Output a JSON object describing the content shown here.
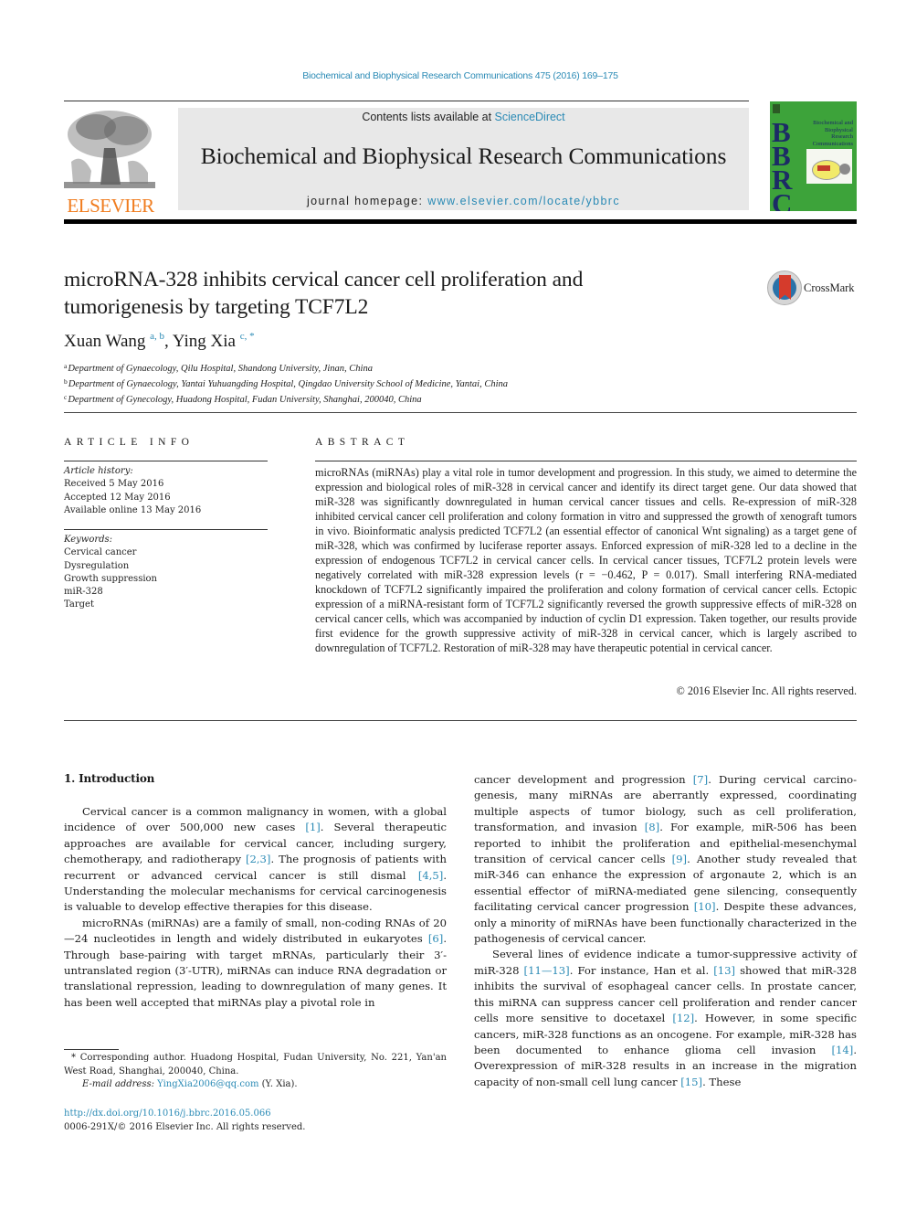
{
  "running_head": "Biochemical and Biophysical Research Communications 475 (2016) 169–175",
  "masthead": {
    "publisher_logo": "ELSEVIER",
    "contents_prefix": "Contents lists available at ",
    "contents_link": "ScienceDirect",
    "journal_title": "Biochemical and Biophysical Research Communications",
    "homepage_prefix": "journal homepage: ",
    "homepage_link": "www.elsevier.com/locate/ybbrc",
    "cover": {
      "letters": [
        "B",
        "B",
        "R",
        "C"
      ],
      "title_lines": [
        "Biochemical and",
        "Biophysical",
        "Research",
        "Communications"
      ],
      "background_color": "#3da33a"
    }
  },
  "article": {
    "title": "microRNA-328 inhibits cervical cancer cell proliferation and tumorigenesis by targeting TCF7L2",
    "crossmark_label": "CrossMark",
    "authors": [
      {
        "name": "Xuan Wang",
        "marks": "a, b"
      },
      {
        "name": "Ying Xia",
        "marks": "c, *"
      }
    ],
    "affiliations": [
      {
        "mark": "a",
        "text": "Department of Gynaecology, Qilu Hospital, Shandong University, Jinan, China"
      },
      {
        "mark": "b",
        "text": "Department of Gynaecology, Yantai Yuhuangding Hospital, Qingdao University School of Medicine, Yantai, China"
      },
      {
        "mark": "c",
        "text": "Department of Gynecology, Huadong Hospital, Fudan University, Shanghai, 200040, China"
      }
    ]
  },
  "article_info": {
    "heading": "ARTICLE INFO",
    "history_label": "Article history:",
    "history": [
      "Received 5 May 2016",
      "Accepted 12 May 2016",
      "Available online 13 May 2016"
    ],
    "keywords_label": "Keywords:",
    "keywords": [
      "Cervical cancer",
      "Dysregulation",
      "Growth suppression",
      "miR-328",
      "Target"
    ]
  },
  "abstract": {
    "heading": "ABSTRACT",
    "text": "microRNAs (miRNAs) play a vital role in tumor development and progression. In this study, we aimed to determine the expression and biological roles of miR-328 in cervical cancer and identify its direct target gene. Our data showed that miR-328 was significantly downregulated in human cervical cancer tissues and cells. Re-expression of miR-328 inhibited cervical cancer cell proliferation and colony formation in vitro and suppressed the growth of xenograft tumors in vivo. Bioinformatic analysis predicted TCF7L2 (an essential effector of canonical Wnt signaling) as a target gene of miR-328, which was confirmed by luciferase reporter assays. Enforced expression of miR-328 led to a decline in the expression of endog­enous TCF7L2 in cervical cancer cells. In cervical cancer tissues, TCF7L2 protein levels were negatively correlated with miR-328 expression levels (r = −0.462, P = 0.017). Small interfering RNA-mediated knockdown of TCF7L2 significantly impaired the proliferation and colony formation of cervical cancer cells. Ectopic expression of a miRNA-resistant form of TCF7L2 significantly reversed the growth sup­pressive effects of miR-328 on cervical cancer cells, which was accompanied by induction of cyclin D1 expression. Taken together, our results provide first evidence for the growth suppressive activity of miR-328 in cervical cancer, which is largely ascribed to downregulation of TCF7L2. Restoration of miR-328 may have therapeutic potential in cervical cancer.",
    "copyright": "© 2016 Elsevier Inc. All rights reserved."
  },
  "body": {
    "section_title": "1.  Introduction",
    "left_paragraphs": [
      [
        {
          "t": "Cervical cancer is a common malignancy in women, with a global incidence of over 500,000 new cases "
        },
        {
          "ref": "[1]"
        },
        {
          "t": ". Several therapeutic approaches are available for cervical cancer, including surgery, chemotherapy, and radiotherapy "
        },
        {
          "ref": "[2,3]"
        },
        {
          "t": ". The prognosis of patients with recurrent or advanced cervical cancer is still dismal "
        },
        {
          "ref": "[4,5]"
        },
        {
          "t": ". Understanding the molecular mechanisms for cervical carcino­genesis is valuable to develop effective therapies for this disease."
        }
      ],
      [
        {
          "t": "microRNAs (miRNAs) are a family of small, non-coding RNAs of 20—24 nucleotides in length and widely distributed in eukaryotes "
        },
        {
          "ref": "[6]"
        },
        {
          "t": ". Through base-pairing with target mRNAs, particularly their 3′-untranslated region (3′-UTR), miRNAs can induce RNA degradation or translational repression, leading to downregulation of many genes. It has been well accepted that miRNAs play a pivotal role in"
        }
      ]
    ],
    "right_paragraphs": [
      [
        {
          "t": "cancer development and progression "
        },
        {
          "ref": "[7]"
        },
        {
          "t": ". During cervical carcino­genesis, many miRNAs are aberrantly expressed, coordinating multiple aspects of tumor biology, such as cell proliferation, transformation, and invasion "
        },
        {
          "ref": "[8]"
        },
        {
          "t": ". For example, miR-506 has been reported to inhibit the proliferation and epithelial-mesenchymal transition of cervical cancer cells "
        },
        {
          "ref": "[9]"
        },
        {
          "t": ". Another study revealed that miR-346 can enhance the expression of argonaute 2, which is an essential effector of miRNA-mediated gene silencing, consequently facilitating cervical cancer progression "
        },
        {
          "ref": "[10]"
        },
        {
          "t": ". Despite these ad­vances, only a minority of miRNAs have been functionally charac­terized in the pathogenesis of cervical cancer."
        }
      ],
      [
        {
          "t": "Several lines of evidence indicate a tumor-suppressive activity of miR-328 "
        },
        {
          "ref": "[11—13]"
        },
        {
          "t": ". For instance, Han et al. "
        },
        {
          "ref": "[13]"
        },
        {
          "t": " showed that miR-328 inhibits the survival of esophageal cancer cells. In prostate cancer, this miRNA can suppress cancer cell proliferation and render cancer cells more sensitive to docetaxel "
        },
        {
          "ref": "[12]"
        },
        {
          "t": ". However, in some specific cancers, miR-328 functions as an oncogene. For example, miR-328 has been documented to enhance glioma cell invasion "
        },
        {
          "ref": "[14]"
        },
        {
          "t": ". Overexpression of miR-328 results in an increase in the migration capacity of non-small cell lung cancer "
        },
        {
          "ref": "[15]"
        },
        {
          "t": ". These"
        }
      ]
    ]
  },
  "footnote": {
    "corresponding": "* Corresponding author. Huadong Hospital, Fudan University, No. 221, Yan'an West Road, Shanghai, 200040, China.",
    "email_label": "E-mail address: ",
    "email": "YingXia2006@qq.com",
    "email_suffix": " (Y. Xia).",
    "doi": "http://dx.doi.org/10.1016/j.bbrc.2016.05.066",
    "issn_line": "0006-291X/© 2016 Elsevier Inc. All rights reserved."
  },
  "colors": {
    "link": "#2a8ab5",
    "elsevier_orange": "#f07c1e",
    "band_gray": "#e8e8e8"
  }
}
